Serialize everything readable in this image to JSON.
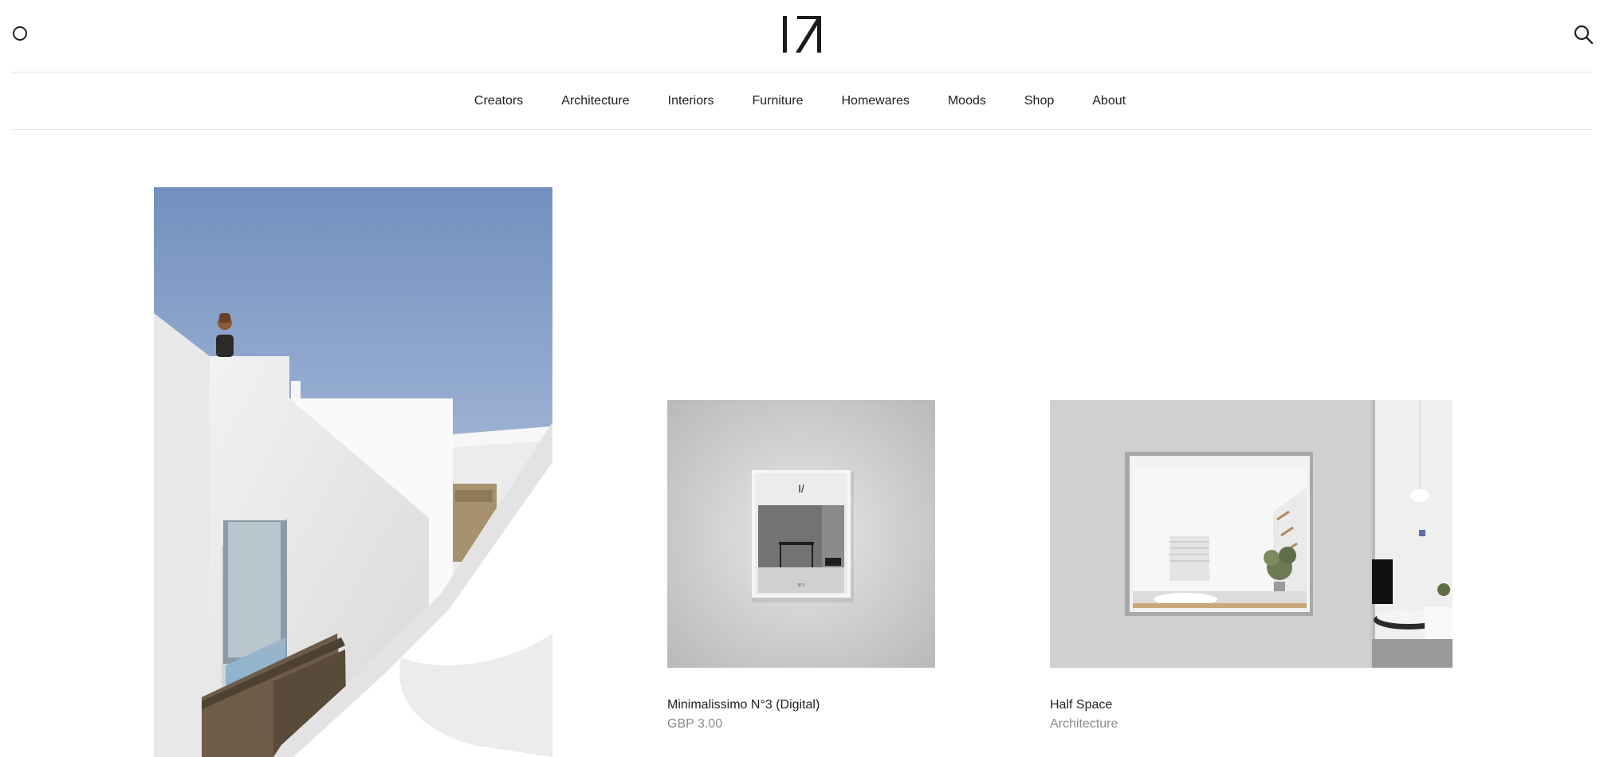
{
  "header": {
    "logo_alt": "Minimalissimo",
    "menu_icon": "circle-menu-icon",
    "search_icon": "search-icon"
  },
  "nav": {
    "items": [
      {
        "label": "Creators"
      },
      {
        "label": "Architecture"
      },
      {
        "label": "Interiors"
      },
      {
        "label": "Furniture"
      },
      {
        "label": "Homewares"
      },
      {
        "label": "Moods"
      },
      {
        "label": "Shop"
      },
      {
        "label": "About"
      }
    ]
  },
  "feature": {
    "image_subject": "white-architecture-with-person-on-rooftop"
  },
  "cards": [
    {
      "title": "Minimalissimo N°3 (Digital)",
      "subtitle": "GBP 3.00"
    },
    {
      "title": "Half Space",
      "subtitle": "Architecture"
    }
  ],
  "colors": {
    "text": "#222222",
    "muted": "#8a8a8a",
    "rule": "#e2e2e2",
    "sky_top": "#7290bf",
    "sky_bottom": "#b9c9df"
  }
}
